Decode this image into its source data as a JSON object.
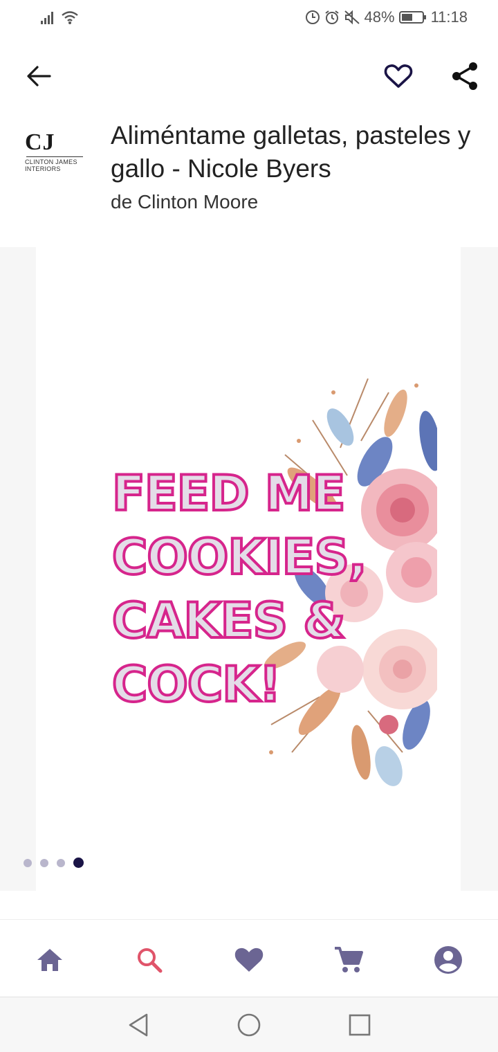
{
  "status_bar": {
    "battery": "48%",
    "time": "11:18"
  },
  "product": {
    "title": "Aliméntame galletas, pasteles y gallo - Nicole Byers",
    "seller": "de Clinton Moore"
  },
  "shop_logo": {
    "mark": "CJ",
    "name_line1": "CLINTON JAMES",
    "name_line2": "INTERIORS"
  },
  "slide": {
    "line1": "FEED ME",
    "line2": "COOKIES,",
    "line3": "CAKES &",
    "line4": "COCK!"
  },
  "carousel": {
    "count": 4,
    "active_index": 3
  },
  "colors": {
    "icon_primary": "#1a1446",
    "nav_icon": "#6b6593",
    "search_accent": "#e0546a",
    "text_stroke": "#d6258c"
  },
  "icons": {
    "back": "arrow-left-icon",
    "favorite": "heart-outline-icon",
    "share": "share-icon",
    "home": "home-icon",
    "search": "search-icon",
    "favorites": "heart-icon",
    "cart": "cart-icon",
    "account": "account-icon"
  }
}
